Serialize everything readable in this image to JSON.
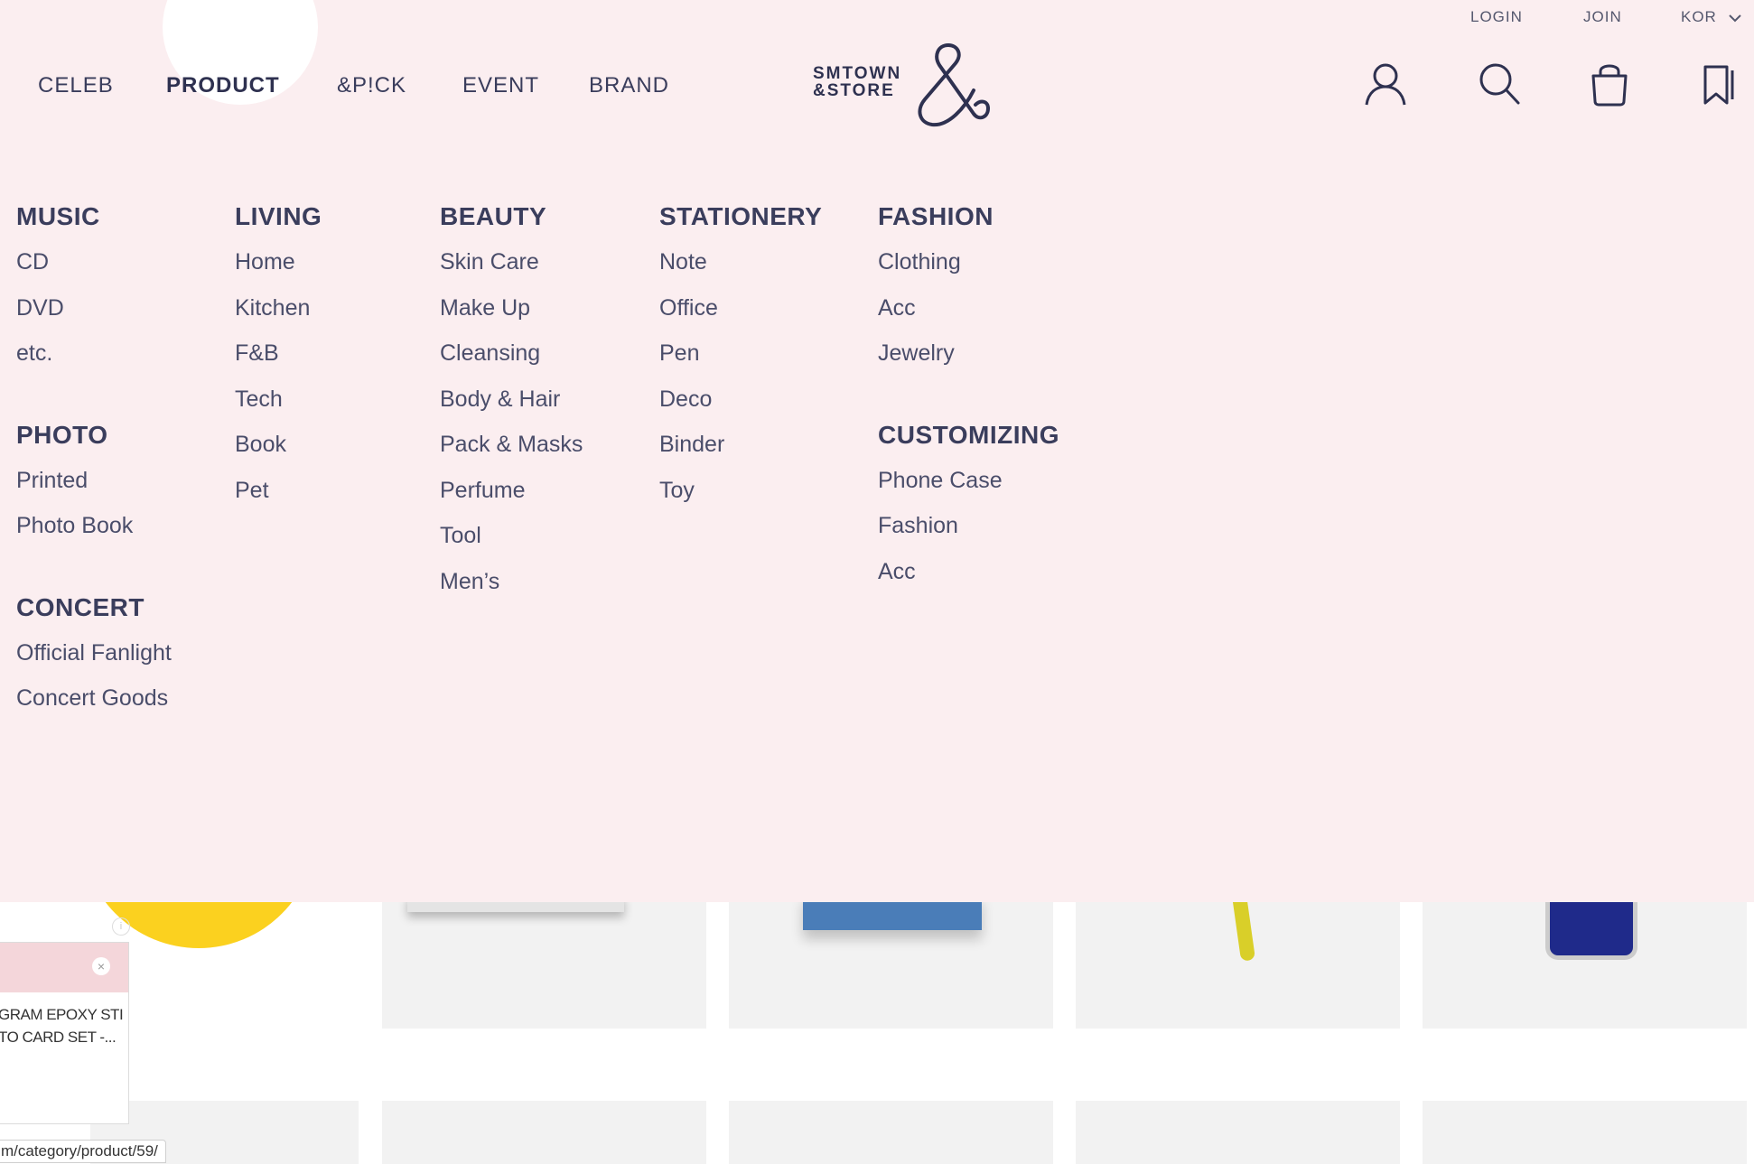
{
  "top_links": {
    "login": "LOGIN",
    "join": "JOIN",
    "language": "KOR"
  },
  "main_nav": [
    {
      "label": "CELEB",
      "active": false
    },
    {
      "label": "PRODUCT",
      "active": true
    },
    {
      "label": "&P!CK",
      "active": false
    },
    {
      "label": "EVENT",
      "active": false
    },
    {
      "label": "BRAND",
      "active": false
    }
  ],
  "logo": {
    "line1": "SMTOWN",
    "line2": "&STORE"
  },
  "header_icons": [
    "user-icon",
    "search-icon",
    "shopping-bag-icon",
    "bookmark-icon"
  ],
  "mega_menu": {
    "col1": [
      {
        "heading": "MUSIC",
        "items": [
          "CD",
          "DVD",
          "etc."
        ]
      },
      {
        "heading": "PHOTO",
        "items": [
          "Printed",
          "Photo Book"
        ]
      },
      {
        "heading": "CONCERT",
        "items": [
          "Official Fanlight",
          "Concert Goods"
        ]
      }
    ],
    "col2": [
      {
        "heading": "LIVING",
        "items": [
          "Home",
          "Kitchen",
          "F&B",
          "Tech",
          "Book",
          "Pet"
        ]
      }
    ],
    "col3": [
      {
        "heading": "BEAUTY",
        "items": [
          "Skin Care",
          "Make Up",
          "Cleansing",
          "Body & Hair",
          "Pack & Masks",
          "Perfume",
          "Tool",
          "Men’s"
        ]
      }
    ],
    "col4": [
      {
        "heading": "STATIONERY",
        "items": [
          "Note",
          "Office",
          "Pen",
          "Deco",
          "Binder",
          "Toy"
        ]
      }
    ],
    "col5": [
      {
        "heading": "FASHION",
        "items": [
          "Clothing",
          "Acc",
          "Jewelry"
        ]
      },
      {
        "heading": "CUSTOMIZING",
        "items": [
          "Phone Case",
          "Fashion",
          "Acc"
        ]
      }
    ]
  },
  "popup": {
    "line1": "GRAM EPOXY STI",
    "line2": "TO CARD SET -...",
    "close": "×"
  },
  "info_mark": "i",
  "status_url": "m/category/product/59/",
  "colors": {
    "panel_bg": "#fbeef0",
    "text": "#3a3d5c",
    "accent_yellow": "#fbd11f"
  }
}
